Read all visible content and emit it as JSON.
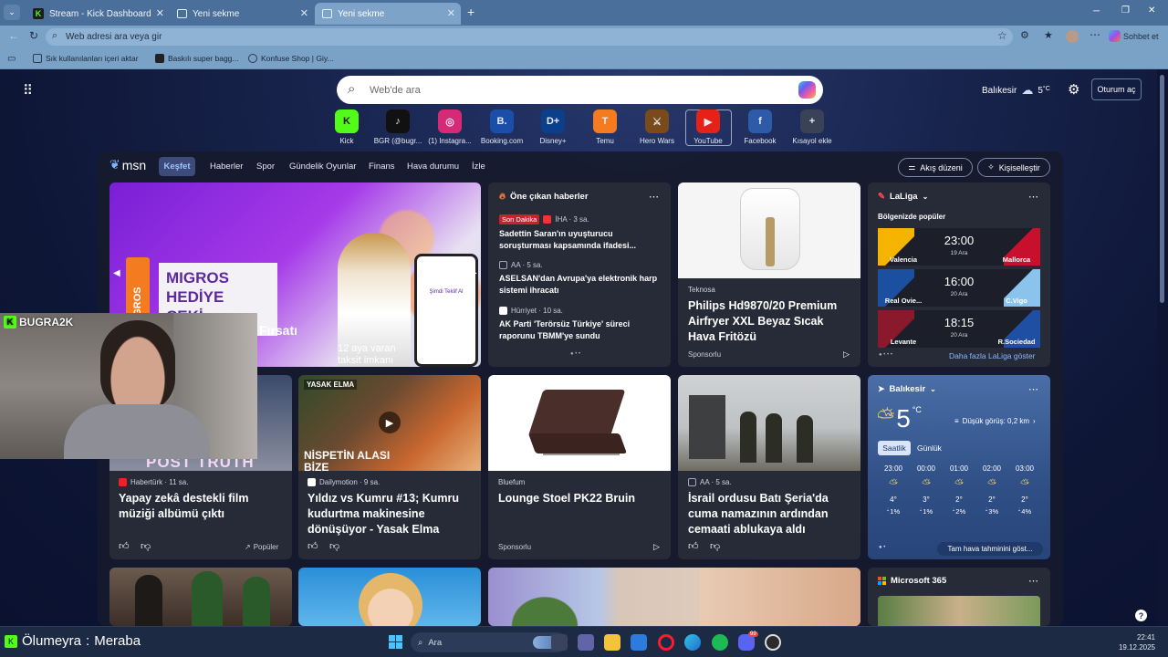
{
  "browser": {
    "tabs": [
      {
        "label": "Stream - Kick Dashboard"
      },
      {
        "label": "Yeni sekme"
      },
      {
        "label": "Yeni sekme"
      }
    ],
    "address_placeholder": "Web adresi ara veya gir",
    "copilot_label": "Sohbet et",
    "bookmarks": [
      {
        "label": "Sık kullanılanları içeri aktar"
      },
      {
        "label": "Baskılı super bagg..."
      },
      {
        "label": "Konfuse Shop | Giy..."
      }
    ]
  },
  "page": {
    "search_placeholder": "Web'de ara",
    "location": "Balıkesir",
    "temperature": "5",
    "temp_unit": "°C",
    "signin": "Oturum aç",
    "tiles": [
      {
        "label": "Kick",
        "glyph": "K",
        "color": "#53fc18"
      },
      {
        "label": "BGR (@bugr...",
        "glyph": "♪",
        "color": "#111111"
      },
      {
        "label": "(1) Instagra...",
        "glyph": "◎",
        "color": "#d62976"
      },
      {
        "label": "Booking.com",
        "glyph": "B.",
        "color": "#1a4ea8"
      },
      {
        "label": "Disney+",
        "glyph": "D+",
        "color": "#0b3f8a"
      },
      {
        "label": "Temu",
        "glyph": "T",
        "color": "#f47b20"
      },
      {
        "label": "Hero Wars",
        "glyph": "⚔",
        "color": "#7a4a1a"
      },
      {
        "label": "YouTube",
        "glyph": "▶",
        "color": "#e62117"
      },
      {
        "label": "Facebook",
        "glyph": "f",
        "color": "#2d5ba8"
      },
      {
        "label": "Kısayol ekle",
        "glyph": "+",
        "color": "#3a4258"
      }
    ]
  },
  "msn": {
    "logo": "msn",
    "nav": [
      "Keşfet",
      "Haberler",
      "Spor",
      "Gündelik Oyunlar",
      "Finans",
      "Hava durumu",
      "İzle"
    ],
    "layout_btn": "Akış düzeni",
    "personalize_btn": "Kişiselleştir",
    "hero": {
      "brand": "MIGROS",
      "line1": "MIGROS",
      "line2": "HEDİYE",
      "line3": "ÇEKİ",
      "overlay": "Fırsatı",
      "sub1": "12 aya varan",
      "sub2": "taksit imkanı",
      "phone_title": "Şimdi Teklif Al"
    },
    "top_news": {
      "title": "Öne çıkan haberler",
      "items": [
        {
          "badge": "Son Dakika",
          "src": "İHA · 3 sa.",
          "text": "Sadettin Saran'ın uyuşturucu soruşturması kapsamında ifadesi..."
        },
        {
          "src": "AA · 5 sa.",
          "text": "ASELSAN'dan Avrupa'ya elektronik harp sistemi ihracatı"
        },
        {
          "src": "Hürriyet · 10 sa.",
          "text": "AK Parti 'Terörsüz Türkiye' süreci raporunu TBMM'ye sundu"
        }
      ]
    },
    "ad_philips": {
      "src": "Teknosa",
      "title": "Philips Hd9870/20 Premium Airfryer XXL Beyaz Sıcak Hava Fritözü",
      "sponsored": "Sponsorlu"
    },
    "laliga": {
      "title": "LaLiga",
      "sub": "Bölgenizde popüler",
      "matches": [
        {
          "home": "Valencia",
          "away": "Mallorca",
          "time": "23:00",
          "date": "19 Ara",
          "hc": "#f4b400",
          "ac": "#c8102e"
        },
        {
          "home": "Real Ovie...",
          "away": "C.Vigo",
          "time": "16:00",
          "date": "20 Ara",
          "hc": "#1b4fa0",
          "ac": "#8ac4ec"
        },
        {
          "home": "Levante",
          "away": "R.Sociedad",
          "time": "18:15",
          "date": "20 Ara",
          "hc": "#8a1a2b",
          "ac": "#1f4fa3"
        }
      ],
      "more": "Daha fazla LaLiga göster"
    },
    "news2": [
      {
        "src": "Habertürk · 11 sa.",
        "title": "Yapay zekâ destekli film müziği albümü çıktı",
        "extra": "Popüler",
        "overlay": "POST TRUTH"
      },
      {
        "src": "Dailymotion · 9 sa.",
        "title": "Yıldız vs Kumru #13; Kumru kudurtma makinesine dönüşüyor - Yasak Elma",
        "tag": "YASAK ELMA",
        "overlay": "NİSPETİN ALASI BİZE"
      },
      {
        "src": "Bluefum",
        "title": "Lounge Stoel PK22 Bruin",
        "sponsored": "Sponsorlu"
      },
      {
        "src": "AA · 5 sa.",
        "title": "İsrail ordusu Batı Şeria'da cuma namazının ardından cemaati ablukaya aldı"
      }
    ],
    "weather": {
      "city": "Balıkesir",
      "temp": "5",
      "unit": "°C",
      "vis": "Düşük görüş: 0,2 km",
      "tab_hourly": "Saatlik",
      "tab_daily": "Günlük",
      "hours": [
        {
          "t": "23:00",
          "temp": "4°",
          "rain": "1%"
        },
        {
          "t": "00:00",
          "temp": "3°",
          "rain": "1%"
        },
        {
          "t": "01:00",
          "temp": "2°",
          "rain": "2%"
        },
        {
          "t": "02:00",
          "temp": "2°",
          "rain": "3%"
        },
        {
          "t": "03:00",
          "temp": "2°",
          "rain": "4%"
        }
      ],
      "full": "Tam hava tahminini göst..."
    },
    "m365": {
      "title": "Microsoft 365"
    }
  },
  "stream": {
    "name": "BUGRA2K",
    "chat_user": "Ölumeyra",
    "chat_msg": "Meraba"
  },
  "taskbar": {
    "search": "Ara",
    "time": "22:41",
    "date": "19.12.2025",
    "badge": "99"
  }
}
